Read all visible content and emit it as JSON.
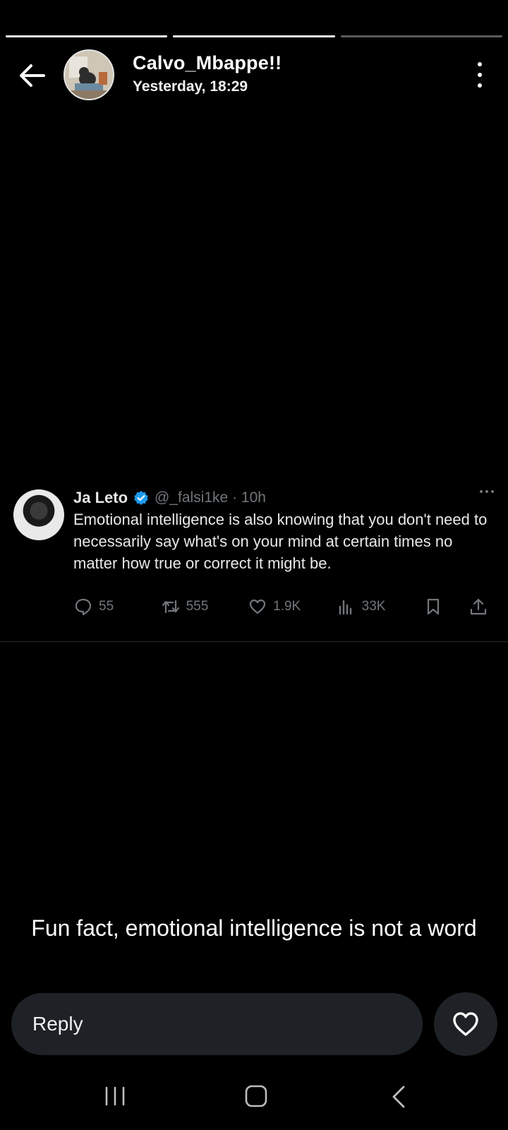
{
  "story": {
    "segments": [
      {
        "progress": 1.0
      },
      {
        "progress": 1.0
      },
      {
        "progress": 0.0
      }
    ]
  },
  "header": {
    "username": "Calvo_Mbappe!!",
    "timestamp": "Yesterday, 18:29",
    "back_icon": "arrow-left-icon",
    "more_icon": "more-vertical-icon"
  },
  "tweet": {
    "name": "Ja Leto",
    "handle_time": "@_falsi1ke · 10h",
    "text": "Emotional intelligence is also knowing that you don't need to necessarily say what's on your mind at certain times no matter how true or correct it might be.",
    "actions": {
      "replies": "55",
      "retweets": "555",
      "likes": "1.9K",
      "views": "33K"
    },
    "accent_color": "#1d9bf0"
  },
  "caption": "Fun fact, emotional intelligence is not a word",
  "reply_bar": {
    "placeholder": "Reply"
  }
}
